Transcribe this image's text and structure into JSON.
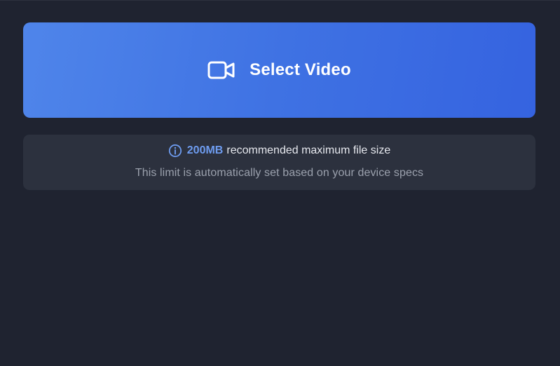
{
  "select_button": {
    "label": "Select Video",
    "icon": "video-camera-icon",
    "gradient_colors": [
      "#4f85ea",
      "#3563e0"
    ]
  },
  "info": {
    "icon": "info-icon",
    "size_value": "200MB",
    "size_text": "recommended maximum file size",
    "subtext": "This limit is automatically set based on your device specs",
    "accent_color": "#6e9cf0"
  },
  "colors": {
    "background": "#1f2330",
    "card": "#2c313e",
    "primary_text": "#e6e8ee",
    "secondary_text": "#9ba1ad"
  }
}
